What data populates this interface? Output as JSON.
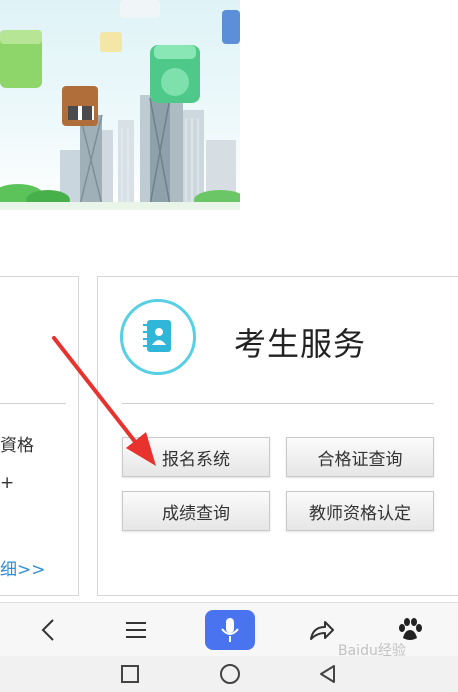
{
  "left_card": {
    "text_1": "資格",
    "text_2": "+",
    "link": "细>>"
  },
  "service_card": {
    "title": "考生服务",
    "buttons": [
      "报名系统",
      "合格证查询",
      "成绩查询",
      "教师资格认定"
    ]
  },
  "toolbar": {
    "icons": [
      "back-icon",
      "menu-icon",
      "microphone-icon",
      "share-icon",
      "baidu-paw-icon"
    ],
    "accent": "#4a73f0"
  },
  "watermark": "Baidu经验",
  "colors": {
    "icon_ring": "#57cfe4",
    "icon_fill": "#2fb6d9",
    "link": "#2f8fd4",
    "arrow": "#e8322d"
  }
}
